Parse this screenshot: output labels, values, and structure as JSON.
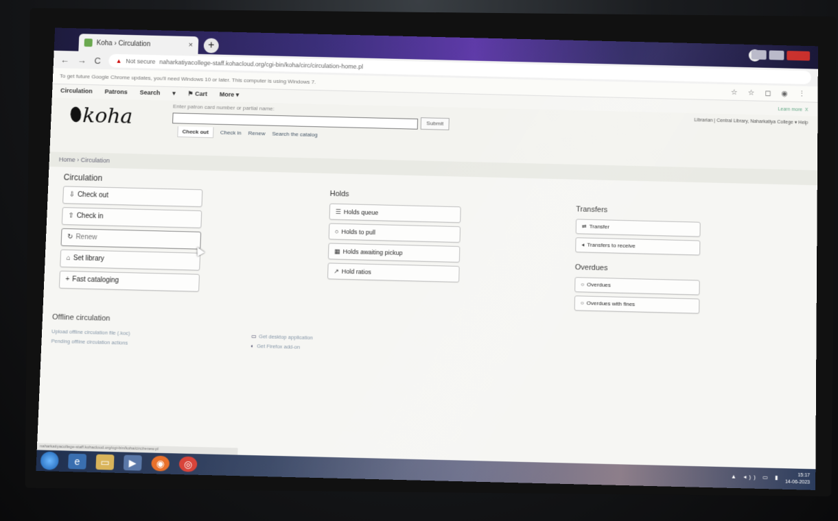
{
  "browser": {
    "tab_title": "Koha › Circulation",
    "tab_close": "×",
    "new_tab": "+",
    "url_security": "Not secure",
    "url": "naharkatiyacollege-staff.kohacloud.org/cgi-bin/koha/circ/circulation-home.pl",
    "nav_back": "←",
    "nav_forward": "→",
    "nav_reload": "C",
    "info_bar": "To get future Google Chrome updates, you'll need Windows 10 or later. This computer is using Windows 7.",
    "learn_more": "Learn more",
    "info_close": "X",
    "toolbar_icons": "☆ ☆ ◻ ◉ ⋮"
  },
  "koha_nav": [
    "Circulation",
    "Patrons",
    "Search",
    "▾",
    "⚑ Cart",
    "More ▾"
  ],
  "header": {
    "logo": "koha",
    "search_label": "Enter patron card number or partial name:",
    "submit": "Submit",
    "search_tabs": [
      "Check out",
      "Check in",
      "Renew",
      "Search the catalog"
    ],
    "user_area": "Librarian | Central Library, Naharkatiya College ▾     Help"
  },
  "breadcrumb": "Home › Circulation",
  "circulation": {
    "title": "Circulation",
    "items": [
      {
        "icon": "⇩",
        "label": "Check out"
      },
      {
        "icon": "⇧",
        "label": "Check in"
      },
      {
        "icon": "↻",
        "label": "Renew"
      },
      {
        "icon": "⌂",
        "label": "Set library"
      },
      {
        "icon": "+",
        "label": "Fast cataloging"
      }
    ]
  },
  "holds": {
    "title": "Holds",
    "items": [
      {
        "icon": "☰",
        "label": "Holds queue"
      },
      {
        "icon": "○",
        "label": "Holds to pull"
      },
      {
        "icon": "▦",
        "label": "Holds awaiting pickup"
      },
      {
        "icon": "↗",
        "label": "Hold ratios"
      }
    ]
  },
  "transfers": {
    "title": "Transfers",
    "items": [
      {
        "icon": "⇄",
        "label": "Transfer"
      },
      {
        "icon": "◂",
        "label": "Transfers to receive"
      }
    ]
  },
  "overdues": {
    "title": "Overdues",
    "items": [
      {
        "icon": "○",
        "label": "Overdues"
      },
      {
        "icon": "○",
        "label": "Overdues with fines"
      }
    ]
  },
  "offline": {
    "title": "Offline circulation",
    "left": [
      "Upload offline circulation file (.koc)",
      "Pending offline circulation actions"
    ],
    "right": [
      {
        "icon": "▭",
        "label": "Get desktop application"
      },
      {
        "icon": "◐",
        "label": "Get Firefox add-on"
      }
    ]
  },
  "status_url": "naharkatiyacollege-staff.kohacloud.org/cgi-bin/koha/circ/renew.pl",
  "taskbar": {
    "tray_icons": "▲ ◂)) ▭ ▮",
    "time": "15:17",
    "date": "14-06-2023"
  }
}
